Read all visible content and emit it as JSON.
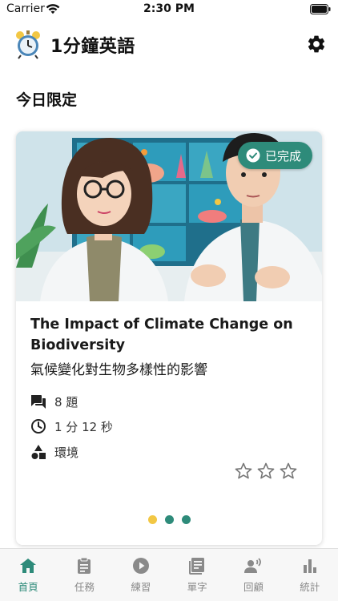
{
  "status_bar": {
    "carrier": "Carrier",
    "time": "2:30 PM"
  },
  "app": {
    "title": "1分鐘英語"
  },
  "section_title": "今日限定",
  "card": {
    "badge_label": "已完成",
    "title_en": "The Impact of Climate Change on Biodiversity",
    "title_zh": "氣候變化對生物多樣性的影響",
    "meta": {
      "questions": "8 題",
      "duration": "1 分 12 秒",
      "category": "環境"
    },
    "rating": {
      "max": 3,
      "value": 0
    }
  },
  "pager": {
    "count": 3,
    "active_index": 0,
    "colors": [
      "#f2c744",
      "#2e8b7a",
      "#2e8b7a"
    ]
  },
  "tabs": [
    {
      "label": "首頁",
      "icon": "home-icon",
      "active": true
    },
    {
      "label": "任務",
      "icon": "clipboard-icon",
      "active": false
    },
    {
      "label": "練習",
      "icon": "play-circle-icon",
      "active": false
    },
    {
      "label": "單字",
      "icon": "notebook-icon",
      "active": false
    },
    {
      "label": "回顧",
      "icon": "speaking-person-icon",
      "active": false
    },
    {
      "label": "統計",
      "icon": "bar-chart-icon",
      "active": false
    }
  ],
  "colors": {
    "accent": "#2e8b7a",
    "inactive": "#8a8a8a",
    "dot_active": "#f2c744"
  }
}
